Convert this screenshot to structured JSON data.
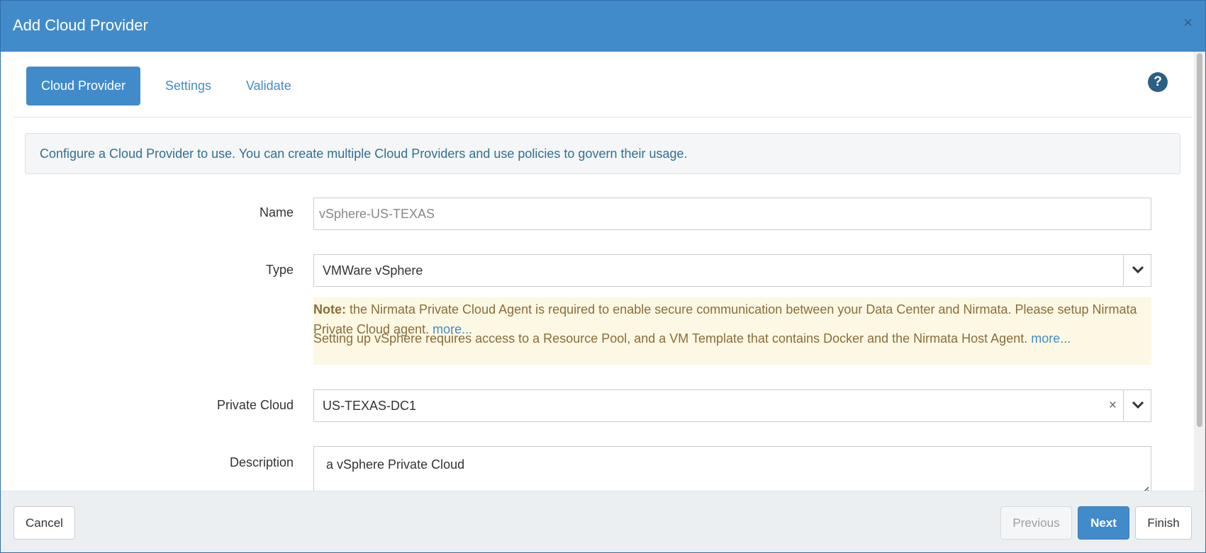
{
  "dialog": {
    "title": "Add Cloud Provider",
    "close_glyph": "×"
  },
  "tabs": [
    {
      "label": "Cloud Provider",
      "active": true
    },
    {
      "label": "Settings",
      "active": false
    },
    {
      "label": "Validate",
      "active": false
    }
  ],
  "help_glyph": "?",
  "info_text": "Configure a Cloud Provider to use. You can create multiple Cloud Providers and use policies to govern their usage.",
  "form": {
    "name": {
      "label": "Name",
      "value": "vSphere-US-TEXAS"
    },
    "type": {
      "label": "Type",
      "value": "VMWare vSphere"
    },
    "note": {
      "bold": "Note:",
      "text1": " the Nirmata Private Cloud Agent is required to enable secure communication between your Data Center and Nirmata. Please setup Nirmata Private Cloud agent. ",
      "link1": "more...",
      "text2": "Setting up vSphere requires access to a Resource Pool, and a VM Template that contains Docker and the Nirmata Host Agent. ",
      "link2": "more..."
    },
    "private_cloud": {
      "label": "Private Cloud",
      "value": "US-TEXAS-DC1",
      "clear_glyph": "×"
    },
    "description": {
      "label": "Description",
      "value": "a vSphere Private Cloud"
    }
  },
  "footer": {
    "cancel": "Cancel",
    "previous": "Previous",
    "next": "Next",
    "finish": "Finish"
  },
  "colors": {
    "primary": "#428bca",
    "note_bg": "#fcf8e3",
    "note_text": "#8a6d3b",
    "info_text": "#31708f"
  },
  "icons": {
    "close": "close-icon",
    "help": "help-icon",
    "dropdown": "chevron-down-icon",
    "clear": "clear-icon",
    "resize": "resize-grip-icon"
  }
}
